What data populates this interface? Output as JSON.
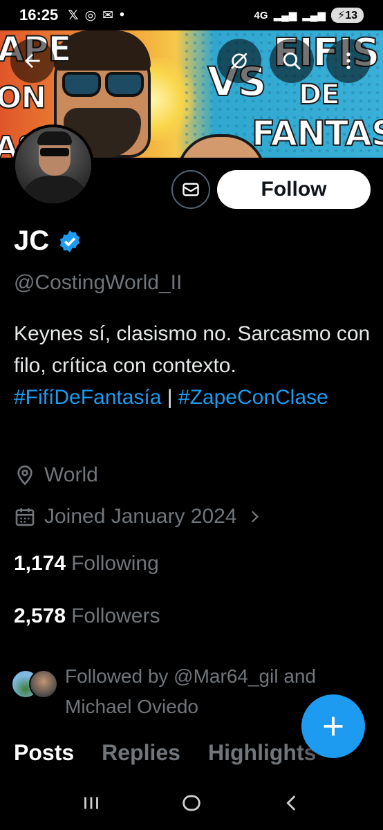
{
  "status_bar": {
    "time": "16:25",
    "battery": "13",
    "network": "4G"
  },
  "banner": {
    "line1": "APE",
    "line2": "ON",
    "line3": "AS",
    "vs": "VS",
    "right1": "FIFIS",
    "right2": "DE",
    "right3": "FANTASÍA"
  },
  "profile": {
    "display_name": "JC",
    "handle": "@CostingWorld_II",
    "bio": {
      "text1": "Keynes sí, clasismo no. Sarcasmo con filo, crítica con contexto. ",
      "tag1": "#FifíDeFantasía",
      "sep": " | ",
      "tag2": "#ZapeConClase"
    },
    "location": "World",
    "joined": "Joined January 2024",
    "following_count": "1,174",
    "following_label": "Following",
    "followers_count": "2,578",
    "followers_label": "Followers",
    "followed_by": "Followed by @Mar64_gil and Michael Oviedo"
  },
  "actions": {
    "follow_label": "Follow"
  },
  "tabs": [
    {
      "label": "Posts"
    },
    {
      "label": "Replies"
    },
    {
      "label": "Highlights"
    }
  ],
  "colors": {
    "accent": "#1d9bf0",
    "background": "#000000",
    "secondary_text": "#71767b"
  }
}
